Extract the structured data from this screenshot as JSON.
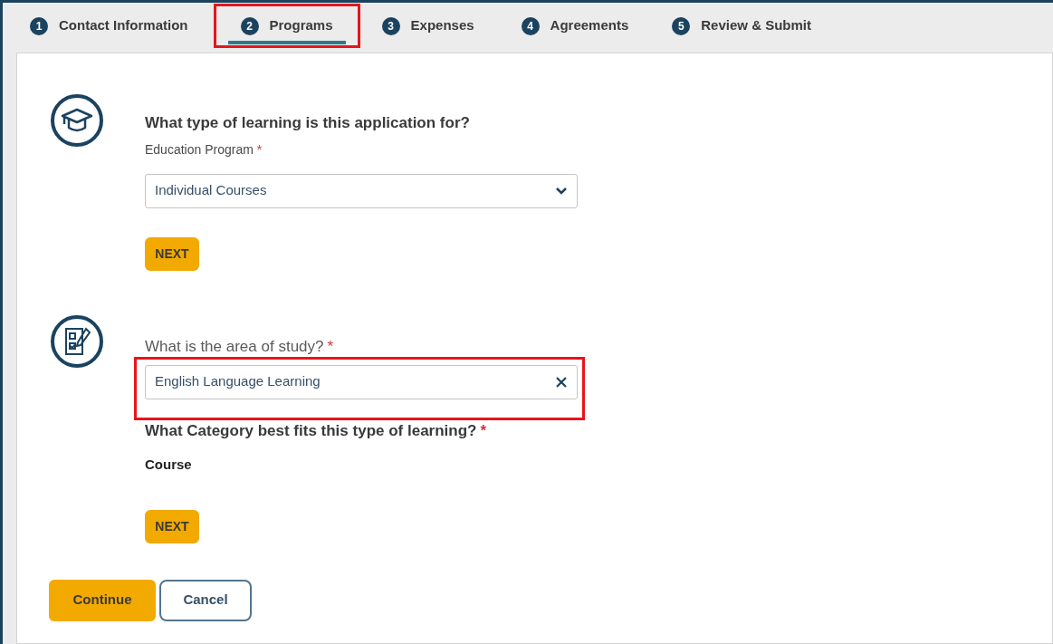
{
  "steps": [
    {
      "number": "1",
      "label": "Contact Information",
      "selected": false,
      "highlighted": false
    },
    {
      "number": "2",
      "label": "Programs",
      "selected": true,
      "highlighted": true
    },
    {
      "number": "3",
      "label": "Expenses",
      "selected": false,
      "highlighted": false
    },
    {
      "number": "4",
      "label": "Agreements",
      "selected": false,
      "highlighted": false
    },
    {
      "number": "5",
      "label": "Review & Submit",
      "selected": false,
      "highlighted": false
    }
  ],
  "sections": [
    {
      "kind": "program",
      "question": "What type of learning is this application for?",
      "field_label": "Education Program",
      "required_mark": "*",
      "select_value": "Individual Courses",
      "next": "NEXT"
    },
    {
      "kind": "study",
      "field_label": "What is the area of study?",
      "required_mark": "*",
      "input_value": "English Language Learning",
      "highlighted": true,
      "category_question": "What Category best fits this type of learning?",
      "category_required_mark": "*",
      "category_value": "Course",
      "next": "NEXT"
    }
  ],
  "actions": {
    "continue": "Continue",
    "cancel": "Cancel"
  }
}
